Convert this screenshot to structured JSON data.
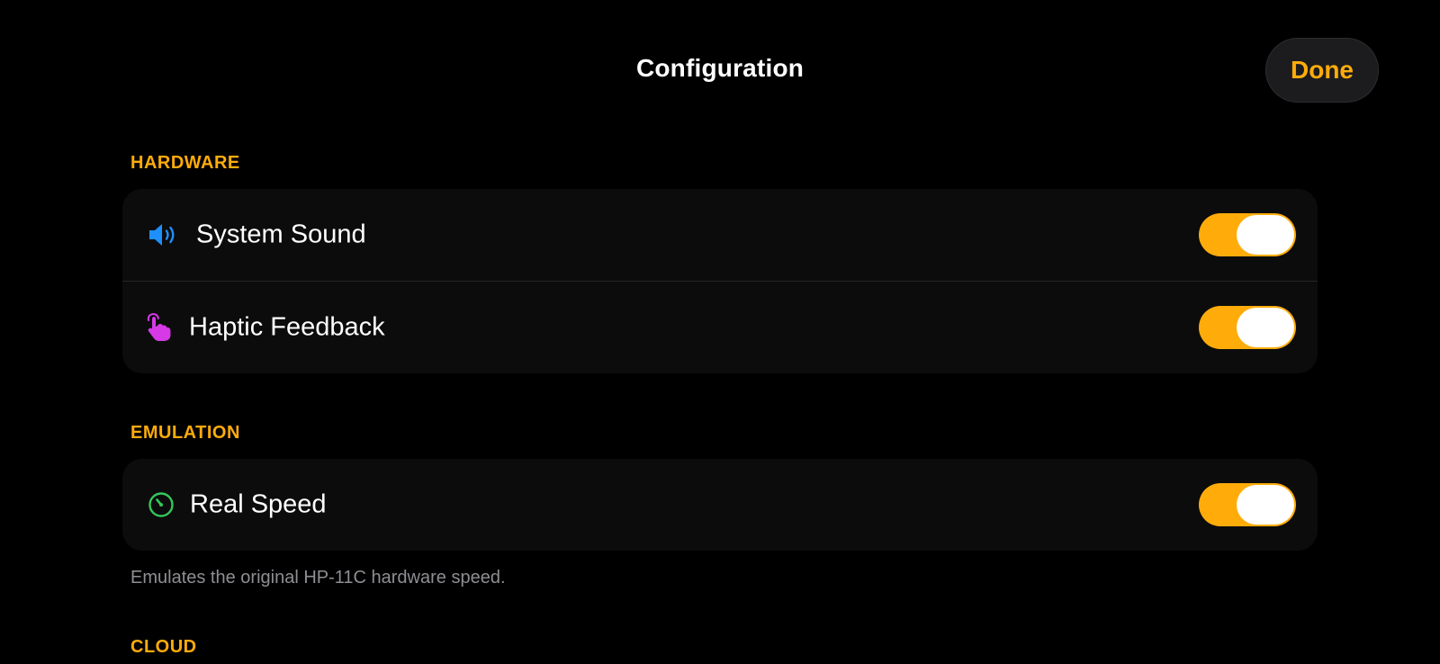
{
  "header": {
    "title": "Configuration",
    "done_label": "Done"
  },
  "colors": {
    "accent": "#ffac0a",
    "background": "#000000",
    "card": "#0c0c0c",
    "sound_icon": "#1e8fff",
    "haptic_icon": "#d53ae6",
    "speed_icon": "#34c759"
  },
  "sections": {
    "hardware": {
      "header": "HARDWARE",
      "rows": [
        {
          "label": "System Sound",
          "icon": "speaker-icon",
          "enabled": true
        },
        {
          "label": "Haptic Feedback",
          "icon": "tap-hand-icon",
          "enabled": true
        }
      ]
    },
    "emulation": {
      "header": "EMULATION",
      "rows": [
        {
          "label": "Real Speed",
          "icon": "gauge-icon",
          "enabled": true
        }
      ],
      "footnote": "Emulates the original HP-11C hardware speed."
    },
    "cloud": {
      "header": "CLOUD"
    }
  }
}
